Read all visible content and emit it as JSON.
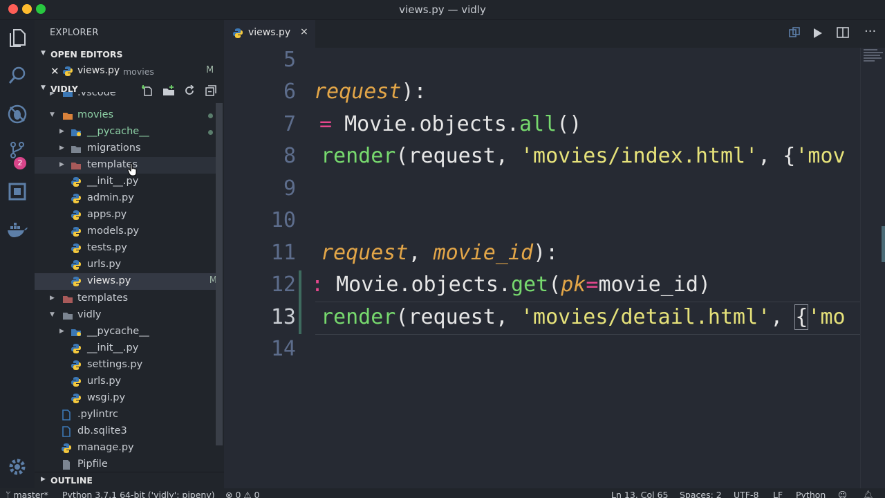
{
  "window": {
    "title": "views.py — vidly"
  },
  "sidebar": {
    "header": "EXPLORER",
    "open_editors_label": "OPEN EDITORS",
    "open_editor": {
      "name": "views.py",
      "folder": "movies",
      "status": "M"
    },
    "project_label": "VIDLY",
    "outline_label": "OUTLINE",
    "source_control_badge": "2",
    "tree": [
      {
        "label": ".vscode"
      },
      {
        "label": "movies"
      },
      {
        "label": "__pycache__"
      },
      {
        "label": "migrations"
      },
      {
        "label": "templates"
      },
      {
        "label": "__init__.py"
      },
      {
        "label": "admin.py"
      },
      {
        "label": "apps.py"
      },
      {
        "label": "models.py"
      },
      {
        "label": "tests.py"
      },
      {
        "label": "urls.py"
      },
      {
        "label": "views.py",
        "status": "M"
      },
      {
        "label": "templates"
      },
      {
        "label": "vidly"
      },
      {
        "label": "__pycache__"
      },
      {
        "label": "__init__.py"
      },
      {
        "label": "settings.py"
      },
      {
        "label": "urls.py"
      },
      {
        "label": "wsgi.py"
      },
      {
        "label": ".pylintrc"
      },
      {
        "label": "db.sqlite3"
      },
      {
        "label": "manage.py"
      },
      {
        "label": "Pipfile"
      }
    ]
  },
  "tab": {
    "label": "views.py",
    "close": "×"
  },
  "editor": {
    "line_numbers": [
      "5",
      "6",
      "7",
      "8",
      "9",
      "10",
      "11",
      "12",
      "13",
      "14"
    ],
    "lines": {
      "l6": {
        "a": "request",
        "b": "):"
      },
      "l7": {
        "a": "= ",
        "b": "Movie.objects.",
        "c": "all",
        "d": "()"
      },
      "l8": {
        "a": "render",
        "b": "(request, ",
        "c": "'movies/index.html'",
        "d": ", {",
        "e": "'mov"
      },
      "l11": {
        "a": "request",
        "b": ", ",
        "c": "movie_id",
        "d": "):"
      },
      "l12": {
        "a": ": ",
        "b": "Movie.objects.",
        "c": "get",
        "d": "(",
        "e": "pk",
        "f": "=",
        "g": "movie_id)"
      },
      "l13": {
        "a": "render",
        "b": "(request, ",
        "c": "'movies/detail.html'",
        "d": ", ",
        "e": "{",
        "f": "'mo"
      }
    }
  },
  "status": {
    "branch": "master*",
    "interpreter": "Python 3.7.1 64-bit ('vidly': pipenv)",
    "problems": "⊗ 0 ⚠ 0",
    "position": "Ln 13, Col 65",
    "spaces": "Spaces: 2",
    "encoding": "UTF-8",
    "eol": "LF",
    "language": "Python"
  }
}
